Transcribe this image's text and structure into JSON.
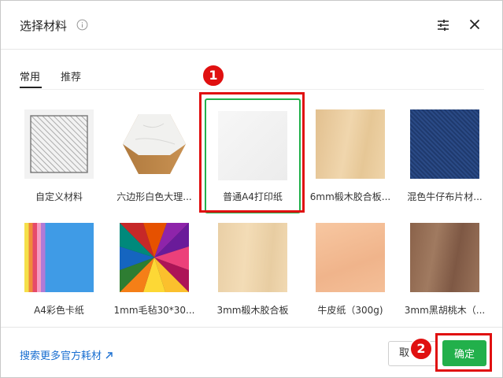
{
  "dialog": {
    "title": "选择材料",
    "info_icon": "info-icon",
    "settings_icon": "sliders-icon",
    "close_icon": "close-icon"
  },
  "tabs": [
    {
      "label": "常用",
      "active": true
    },
    {
      "label": "推荐",
      "active": false
    }
  ],
  "materials": [
    {
      "label": "自定义材料",
      "thumb": "hatched-square"
    },
    {
      "label": "六边形白色大理...",
      "thumb": "marble-hexagon"
    },
    {
      "label": "普通A4打印纸",
      "thumb": "white-paper",
      "selected": true
    },
    {
      "label": "6mm椴木胶合板...",
      "thumb": "light-plywood"
    },
    {
      "label": "混色牛仔布片材...",
      "thumb": "denim"
    },
    {
      "label": "A4彩色卡纸",
      "thumb": "color-card-stack"
    },
    {
      "label": "1mm毛毡30*30...",
      "thumb": "color-felt-wheel"
    },
    {
      "label": "3mm椴木胶合板",
      "thumb": "light-plywood"
    },
    {
      "label": "牛皮纸（300g)",
      "thumb": "kraft-paper"
    },
    {
      "label": "3mm黑胡桃木（...",
      "thumb": "walnut-wood"
    }
  ],
  "footer": {
    "more_link": "搜索更多官方耗材",
    "cancel_label": "取",
    "ok_label": "确定"
  },
  "annotations": {
    "step1": "1",
    "step2": "2",
    "color": "#e01010"
  },
  "colors": {
    "accent_green": "#22b04b",
    "link_blue": "#1a6fd1"
  }
}
